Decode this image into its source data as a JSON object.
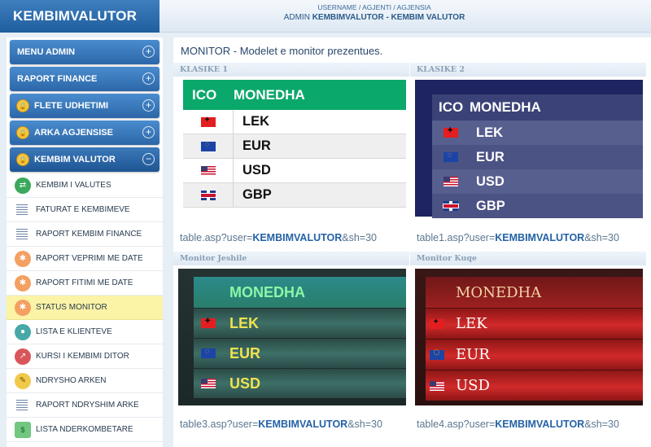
{
  "app": {
    "title": "KEMBIMVALUTOR"
  },
  "header": {
    "path": "USERNAME / AGJENTI / AGJENSIA",
    "role_prefix": "ADMIN",
    "role_name": "KEMBIMVALUTOR - KEMBIM VALUTOR"
  },
  "sidebar": {
    "heads": [
      {
        "label": "MENU ADMIN",
        "toggle": "+"
      },
      {
        "label": "RAPORT FINANCE",
        "toggle": "+"
      },
      {
        "label": "FLETE UDHETIMI",
        "toggle": "+"
      },
      {
        "label": "ARKA AGJENSISE",
        "toggle": "+"
      },
      {
        "label": "KEMBIM VALUTOR",
        "toggle": "−"
      }
    ],
    "items": [
      {
        "label": "KEMBIM I VALUTES",
        "icon": "exchange-icon"
      },
      {
        "label": "FATURAT E KEMBIMEVE",
        "icon": "list-icon"
      },
      {
        "label": "RAPORT KEMBIM FINANCE",
        "icon": "list-icon"
      },
      {
        "label": "RAPORT VEPRIMI ME DATE",
        "icon": "calendar-icon"
      },
      {
        "label": "RAPORT FITIMI ME DATE",
        "icon": "calendar-icon"
      },
      {
        "label": "STATUS MONITOR",
        "icon": "monitor-icon"
      },
      {
        "label": "LISTA E KLIENTEVE",
        "icon": "user-icon"
      },
      {
        "label": "KURSI I KEMBIMI DITOR",
        "icon": "chart-icon"
      },
      {
        "label": "NDRYSHO ARKEN",
        "icon": "edit-icon"
      },
      {
        "label": "RAPORT NDRYSHIM ARKE",
        "icon": "list-icon"
      },
      {
        "label": "LISTA NDERKOMBETARE",
        "icon": "money-icon"
      }
    ]
  },
  "main": {
    "title": "MONITOR - Modelet e monitor prezentues.",
    "panels": [
      {
        "name": "KLASIKE 1",
        "link_prefix": "table.asp?user=",
        "link_user": "KEMBIMVALUTOR",
        "link_suffix": "&sh=30"
      },
      {
        "name": "KLASIKE 2",
        "link_prefix": "table1.asp?user=",
        "link_user": "KEMBIMVALUTOR",
        "link_suffix": "&sh=30"
      },
      {
        "name": "Monitor Jeshile",
        "link_prefix": "table3.asp?user=",
        "link_user": "KEMBIMVALUTOR",
        "link_suffix": "&sh=30"
      },
      {
        "name": "Monitor Kuqe",
        "link_prefix": "table4.asp?user=",
        "link_user": "KEMBIMVALUTOR",
        "link_suffix": "&sh=30"
      }
    ],
    "table": {
      "col_ico": "ICO",
      "col_currency": "MONEDHA",
      "currencies": [
        "LEK",
        "EUR",
        "USD",
        "GBP"
      ]
    }
  },
  "colors": {
    "brand_blue": "#2c67a8",
    "selected_item": "#fbf3a6",
    "klasike1_header": "#0ba86b",
    "klasike2_bg": "#1e2460",
    "jeshile_text": "#f1e150",
    "kuqe_row": "#d22a2a"
  }
}
